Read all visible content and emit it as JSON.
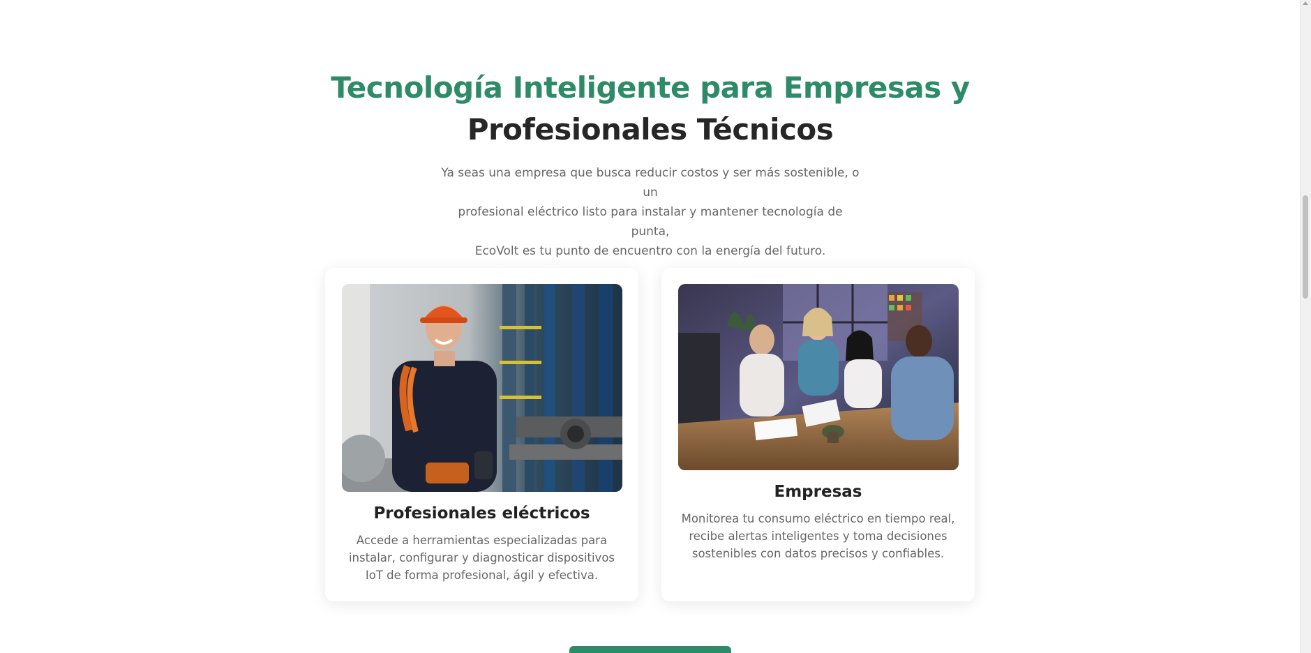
{
  "section": {
    "heading_accent": "Tecnología Inteligente para Empresas y",
    "heading_dark": "Profesionales Técnicos",
    "intro_lines": [
      "Ya seas una empresa que busca reducir costos y ser más sostenible, o un",
      "profesional eléctrico listo para instalar y mantener tecnología de punta,",
      "EcoVolt es tu punto de encuentro con la energía del futuro."
    ]
  },
  "cards": [
    {
      "title": "Profesionales eléctricos",
      "text": "Accede a herramientas especializadas para instalar, configurar y diagnosticar dispositivos IoT de forma profesional, ágil y efectiva.",
      "image": "electrician-photo"
    },
    {
      "title": "Empresas",
      "text": "Monitorea tu consumo eléctrico en tiempo real, recibe alertas inteligentes y toma decisiones sostenibles con datos precisos y confiables.",
      "image": "business-meeting-photo"
    }
  ],
  "colors": {
    "accent": "#2e8b68",
    "heading_dark": "#262626",
    "body_text": "#666666"
  }
}
